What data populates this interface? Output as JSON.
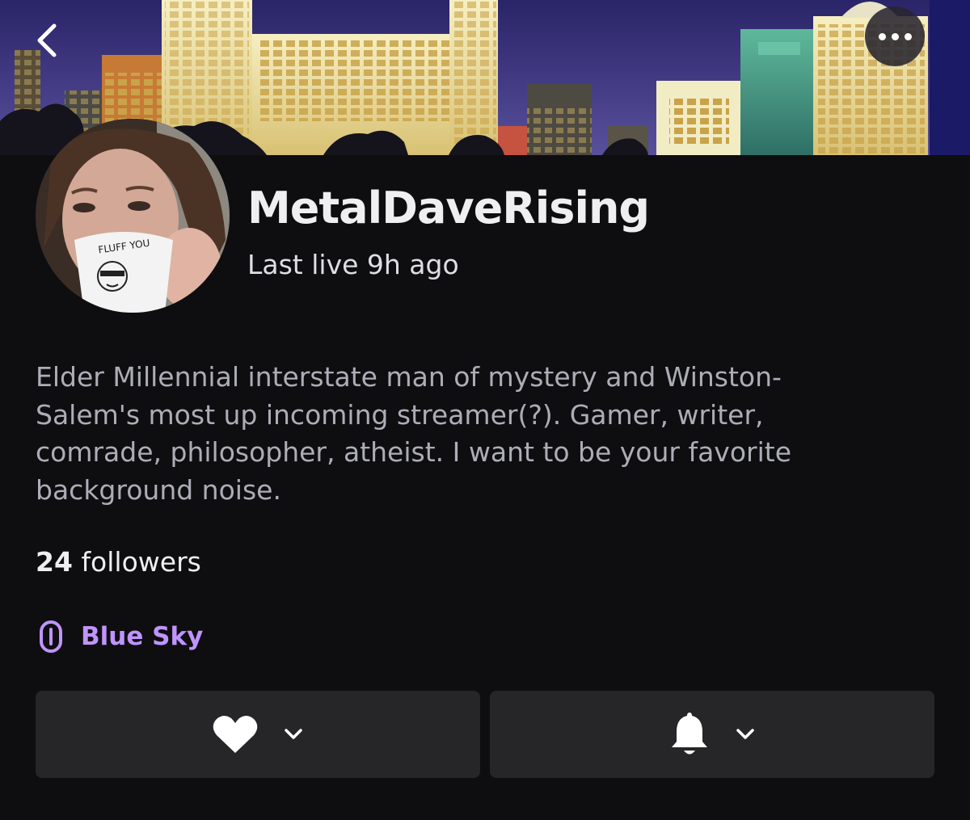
{
  "header": {
    "back_icon": "chevron-left-icon",
    "more_icon": "more-horizontal-icon",
    "banner_image": "city-skyline-at-night"
  },
  "profile": {
    "avatar_image": "man-with-long-hair-holding-mug",
    "mug_text": "FLUFF YOU",
    "channel_name": "MetalDaveRising",
    "last_live": "Last live 9h ago"
  },
  "bio": {
    "lines": [
      "Elder Millennial interstate man of mystery and Winston-",
      "Salem's most up incoming streamer(?). Gamer, writer,",
      "comrade, philosopher, atheist. I want to be your favorite",
      "background noise."
    ]
  },
  "stats": {
    "followers_count": "24",
    "followers_label": "followers"
  },
  "social": {
    "icon": "link-icon",
    "label": "Blue Sky"
  },
  "actions": {
    "follow_icon": "heart-icon",
    "notify_icon": "bell-icon",
    "dropdown_icon": "chevron-down-icon"
  },
  "colors": {
    "background": "#0e0e10",
    "button_bg": "#262629",
    "accent": "#bf94ff",
    "primary_text": "#efeff1",
    "secondary_text": "#adadb8"
  }
}
